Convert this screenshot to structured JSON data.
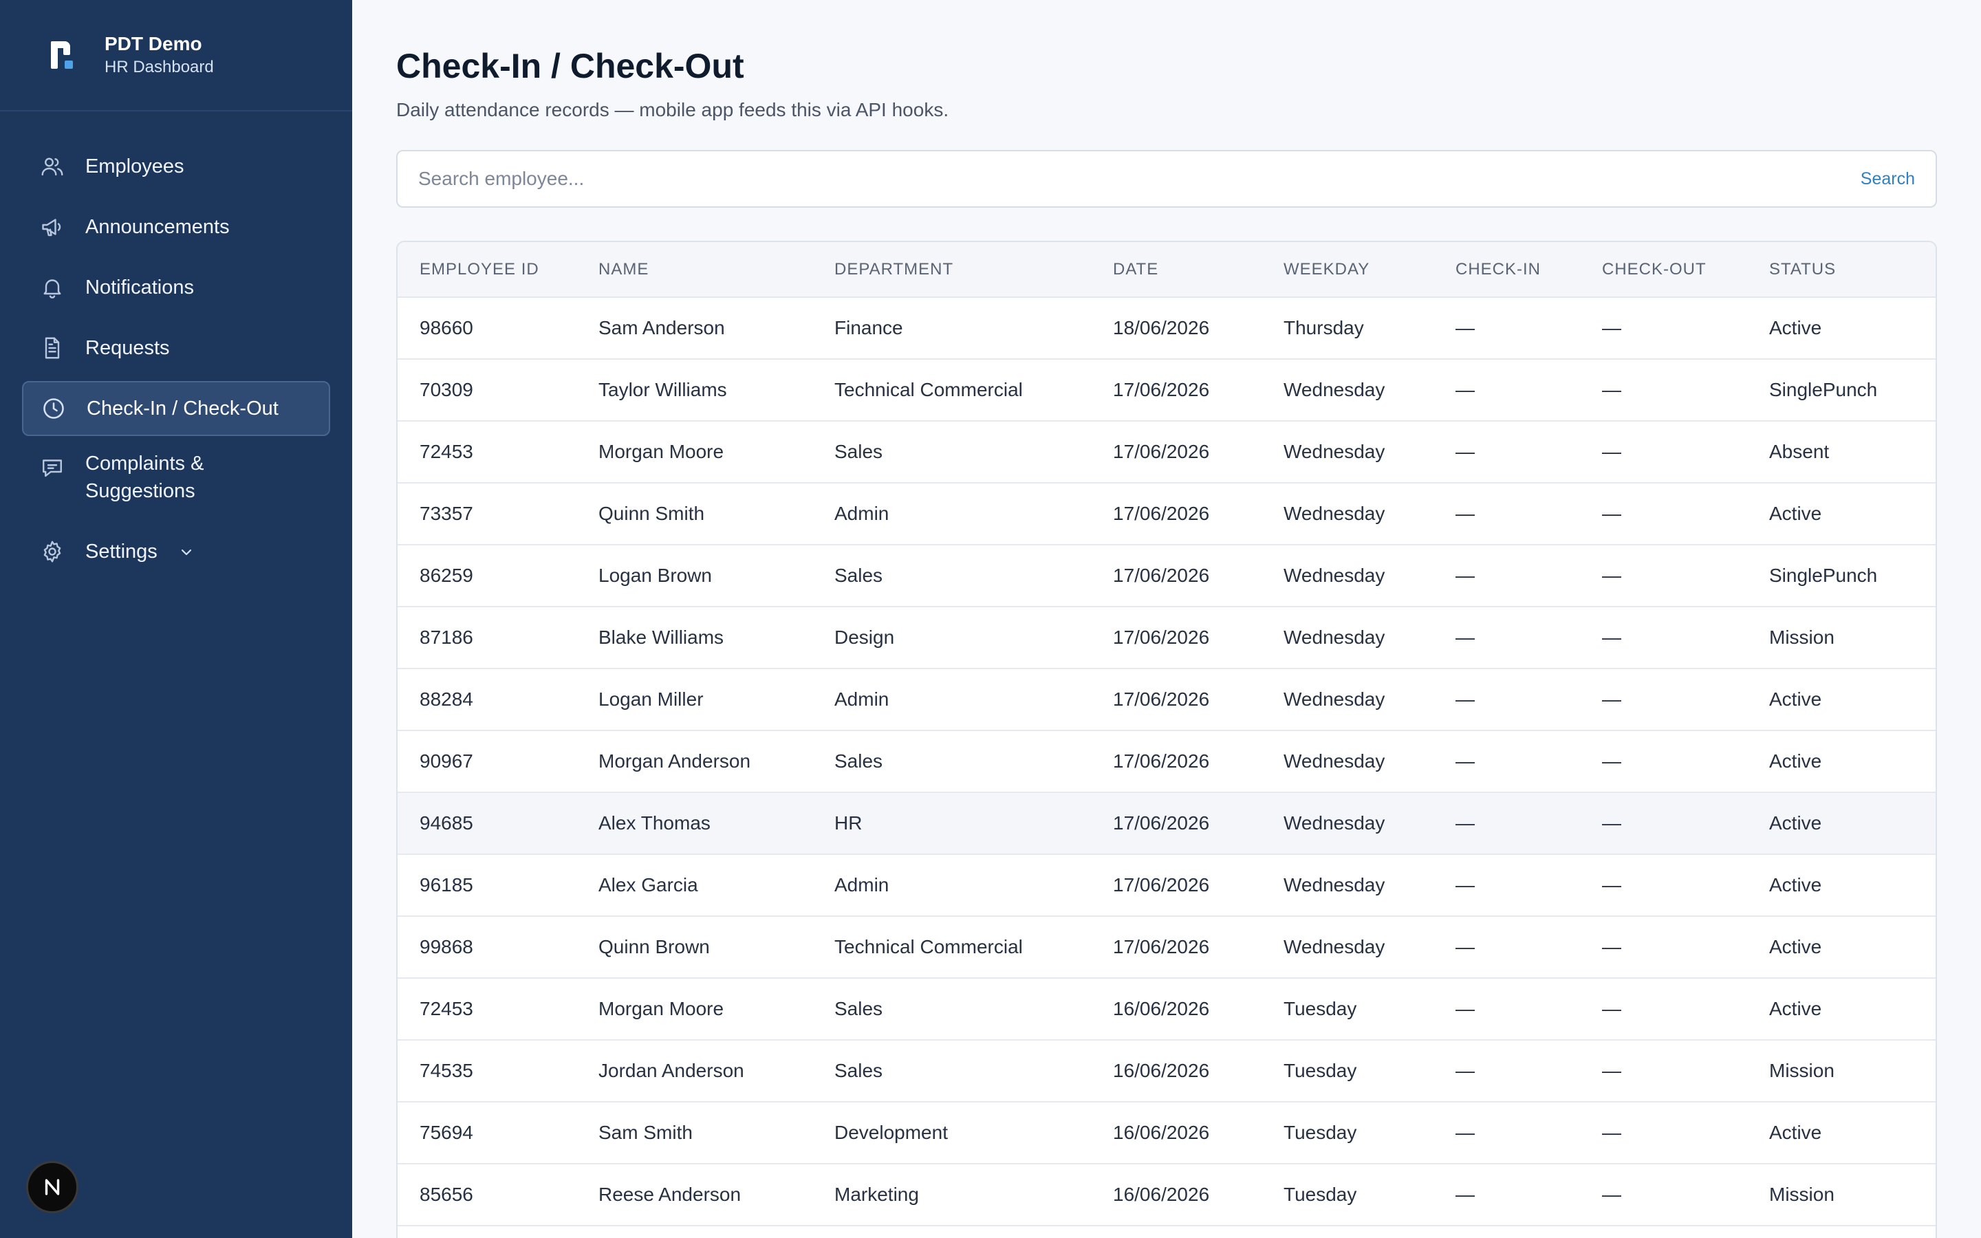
{
  "brand": {
    "name": "PDT Demo",
    "subtitle": "HR Dashboard"
  },
  "sidebar": {
    "items": [
      {
        "label": "Employees",
        "icon": "users-icon"
      },
      {
        "label": "Announcements",
        "icon": "megaphone-icon"
      },
      {
        "label": "Notifications",
        "icon": "bell-icon"
      },
      {
        "label": "Requests",
        "icon": "document-icon"
      },
      {
        "label": "Check-In / Check-Out",
        "icon": "clock-icon",
        "active": true
      },
      {
        "label": "Complaints & Suggestions",
        "icon": "chat-icon"
      },
      {
        "label": "Settings",
        "icon": "gear-icon",
        "expandable": true
      }
    ],
    "badge": "N"
  },
  "page": {
    "title": "Check-In / Check-Out",
    "subtitle": "Daily attendance records — mobile app feeds this via API hooks."
  },
  "search": {
    "placeholder": "Search employee...",
    "button": "Search"
  },
  "table": {
    "columns": [
      "EMPLOYEE ID",
      "NAME",
      "DEPARTMENT",
      "DATE",
      "WEEKDAY",
      "CHECK-IN",
      "CHECK-OUT",
      "STATUS"
    ],
    "rows": [
      [
        "98660",
        "Sam Anderson",
        "Finance",
        "18/06/2026",
        "Thursday",
        "—",
        "—",
        "Active"
      ],
      [
        "70309",
        "Taylor Williams",
        "Technical Commercial",
        "17/06/2026",
        "Wednesday",
        "—",
        "—",
        "SinglePunch"
      ],
      [
        "72453",
        "Morgan Moore",
        "Sales",
        "17/06/2026",
        "Wednesday",
        "—",
        "—",
        "Absent"
      ],
      [
        "73357",
        "Quinn Smith",
        "Admin",
        "17/06/2026",
        "Wednesday",
        "—",
        "—",
        "Active"
      ],
      [
        "86259",
        "Logan Brown",
        "Sales",
        "17/06/2026",
        "Wednesday",
        "—",
        "—",
        "SinglePunch"
      ],
      [
        "87186",
        "Blake Williams",
        "Design",
        "17/06/2026",
        "Wednesday",
        "—",
        "—",
        "Mission"
      ],
      [
        "88284",
        "Logan Miller",
        "Admin",
        "17/06/2026",
        "Wednesday",
        "—",
        "—",
        "Active"
      ],
      [
        "90967",
        "Morgan Anderson",
        "Sales",
        "17/06/2026",
        "Wednesday",
        "—",
        "—",
        "Active"
      ],
      [
        "94685",
        "Alex Thomas",
        "HR",
        "17/06/2026",
        "Wednesday",
        "—",
        "—",
        "Active"
      ],
      [
        "96185",
        "Alex Garcia",
        "Admin",
        "17/06/2026",
        "Wednesday",
        "—",
        "—",
        "Active"
      ],
      [
        "99868",
        "Quinn Brown",
        "Technical Commercial",
        "17/06/2026",
        "Wednesday",
        "—",
        "—",
        "Active"
      ],
      [
        "72453",
        "Morgan Moore",
        "Sales",
        "16/06/2026",
        "Tuesday",
        "—",
        "—",
        "Active"
      ],
      [
        "74535",
        "Jordan Anderson",
        "Sales",
        "16/06/2026",
        "Tuesday",
        "—",
        "—",
        "Mission"
      ],
      [
        "75694",
        "Sam Smith",
        "Development",
        "16/06/2026",
        "Tuesday",
        "—",
        "—",
        "Active"
      ],
      [
        "85656",
        "Reese Anderson",
        "Marketing",
        "16/06/2026",
        "Tuesday",
        "—",
        "—",
        "Mission"
      ],
      [
        "",
        "",
        "",
        "",
        "",
        "",
        "",
        ""
      ]
    ],
    "highlighted_row": 8
  },
  "colors": {
    "sidebar": "#1c365c",
    "accent": "#2f80c4",
    "background": "#f6f8fb"
  }
}
